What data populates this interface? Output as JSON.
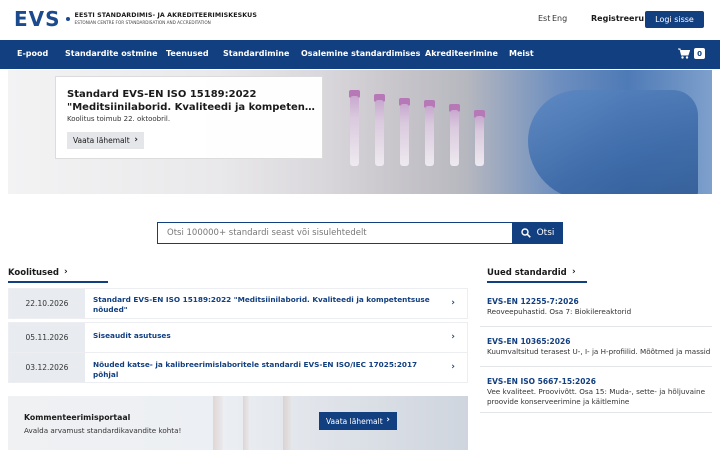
{
  "header": {
    "logo_mark": "EVS",
    "logo_line1": "EESTI STANDARDIMIS- JA AKREDITEERIMISKESKUS",
    "logo_line2": "ESTONIAN CENTRE FOR STANDARDISATION AND ACCREDITATION",
    "lang_est": "Est",
    "lang_eng": "Eng",
    "register": "Registreeru",
    "login": "Logi sisse"
  },
  "nav": {
    "items": [
      "E-pood",
      "Standardite ostmine",
      "Teenused",
      "Standardimine",
      "Osalemine standardimises",
      "Akrediteerimine",
      "Meist"
    ],
    "cart_count": "0"
  },
  "hero": {
    "title_line1": "Standard EVS-EN ISO 15189:2022",
    "title_line2": "\"Meditsiinilaborid. Kvaliteedi ja kompetentsuse…",
    "subtitle": "Koolitus toimub 22. oktoobril.",
    "button": "Vaata lähemalt",
    "active_slide": 1,
    "slide_count": 3
  },
  "search": {
    "placeholder": "Otsi 100000+ standardi seast või sisulehtedelt",
    "button": "Otsi"
  },
  "courses": {
    "title": "Koolitused",
    "items": [
      {
        "date": "22.10.2026",
        "title": "Standard EVS-EN ISO 15189:2022 \"Meditsiinilaborid. Kvaliteedi ja kompetentsuse nõuded\""
      },
      {
        "date": "05.11.2026",
        "title": "Siseaudit asutuses"
      },
      {
        "date": "03.12.2026",
        "title": "Nõuded katse- ja kalibreerimislaboritele standardi EVS-EN ISO/IEC 17025:2017 põhjal"
      }
    ]
  },
  "new_standards": {
    "title": "Uued standardid",
    "items": [
      {
        "code": "EVS-EN 12255-7:2026",
        "desc": "Reoveepuhastid. Osa 7: Biokilereaktorid"
      },
      {
        "code": "EVS-EN 10365:2026",
        "desc": "Kuumvaltsitud terasest U-, I- ja H-profiilid. Mõõtmed ja massid"
      },
      {
        "code": "EVS-EN ISO 5667-15:2026",
        "desc": "Vee kvaliteet. Proovivõtt. Osa 15: Muda-, sette- ja hõljuvaine proovide konserveerimine ja käitlemine"
      }
    ]
  },
  "comment": {
    "title": "Kommenteerimisportaal",
    "subtitle": "Avalda arvamust standardikavandite kohta!",
    "button": "Vaata lähemalt"
  },
  "colors": {
    "primary": "#123f80",
    "row_date_bg": "#e8ebf0"
  }
}
